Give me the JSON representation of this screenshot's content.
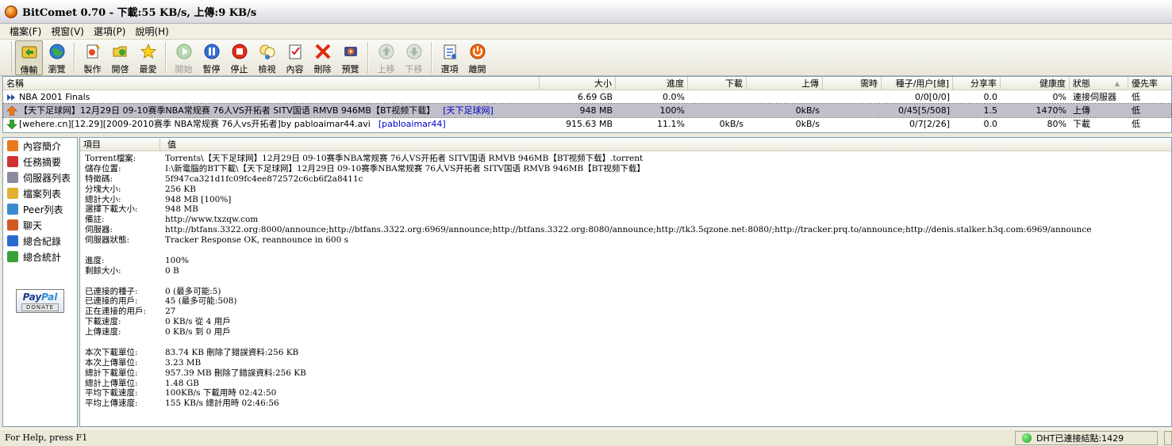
{
  "window": {
    "title": "BitComet 0.70 - 下載:55 KB/s, 上傳:9 KB/s"
  },
  "menu": [
    "檔案(F)",
    "視窗(V)",
    "選項(P)",
    "說明(H)"
  ],
  "toolbar": {
    "buttons": [
      {
        "label": "傳輸",
        "icon": "transfer-icon",
        "active": true,
        "disabled": false
      },
      {
        "label": "瀏覽",
        "icon": "globe-icon",
        "active": false,
        "disabled": false
      },
      {
        "label": "製作",
        "icon": "make-torrent-icon",
        "active": false,
        "disabled": false
      },
      {
        "label": "開啓",
        "icon": "open-folder-icon",
        "active": false,
        "disabled": false
      },
      {
        "label": "最愛",
        "icon": "star-icon",
        "active": false,
        "disabled": false
      },
      {
        "label": "開始",
        "icon": "play-icon",
        "active": false,
        "disabled": true
      },
      {
        "label": "暫停",
        "icon": "pause-icon",
        "active": false,
        "disabled": false
      },
      {
        "label": "停止",
        "icon": "stop-icon",
        "active": false,
        "disabled": false
      },
      {
        "label": "檢視",
        "icon": "view-icon",
        "active": false,
        "disabled": false
      },
      {
        "label": "內容",
        "icon": "properties-icon",
        "active": false,
        "disabled": false
      },
      {
        "label": "刪除",
        "icon": "delete-icon",
        "active": false,
        "disabled": false
      },
      {
        "label": "預覽",
        "icon": "preview-icon",
        "active": false,
        "disabled": false
      },
      {
        "label": "上移",
        "icon": "move-up-icon",
        "active": false,
        "disabled": true
      },
      {
        "label": "下移",
        "icon": "move-down-icon",
        "active": false,
        "disabled": true
      },
      {
        "label": "選項",
        "icon": "options-icon",
        "active": false,
        "disabled": false
      },
      {
        "label": "離開",
        "icon": "exit-icon",
        "active": false,
        "disabled": false
      }
    ]
  },
  "list": {
    "columns": [
      "名稱",
      "大小",
      "進度",
      "下載",
      "上傳",
      "需時",
      "種子/用户[總]",
      "分享率",
      "健康度",
      "狀態",
      "優先率"
    ],
    "rows": [
      {
        "icon": "double-arrow-icon",
        "name": "NBA 2001 Finals",
        "tag": "",
        "size": "6.69 GB",
        "progress": "0.0%",
        "down": "",
        "up": "",
        "eta": "",
        "peers": "0/0[0/0]",
        "ratio": "0.0",
        "health": "0%",
        "status": "連接伺服器",
        "priority": "低",
        "selected": false
      },
      {
        "icon": "upload-arrow-icon",
        "name": "【天下足球网】12月29日 09-10赛季NBA常规赛 76人VS开拓者 SITV国语 RMVB 946MB【BT视频下载】",
        "tag": "[天下足球网]",
        "size": "948 MB",
        "progress": "100%",
        "down": "",
        "up": "0kB/s",
        "eta": "",
        "peers": "0/45[5/508]",
        "ratio": "1.5",
        "health": "1470%",
        "status": "上傳",
        "priority": "低",
        "selected": true
      },
      {
        "icon": "download-arrow-icon",
        "name": "[wehere.cn][12.29][2009-2010赛季 NBA常规赛 76人vs开拓者]by pabloaimar44.avi",
        "tag": "[pabloaimar44]",
        "size": "915.63 MB",
        "progress": "11.1%",
        "down": "0kB/s",
        "up": "0kB/s",
        "eta": "",
        "peers": "0/7[2/26]",
        "ratio": "0.0",
        "health": "80%",
        "status": "下載",
        "priority": "低",
        "selected": false
      }
    ]
  },
  "nav": {
    "items": [
      {
        "label": "內容簡介",
        "icon": "info-icon"
      },
      {
        "label": "任務摘要",
        "icon": "task-summary-icon"
      },
      {
        "label": "伺服器列表",
        "icon": "server-list-icon"
      },
      {
        "label": "檔案列表",
        "icon": "file-list-icon"
      },
      {
        "label": "Peer列表",
        "icon": "peer-list-icon"
      },
      {
        "label": "聊天",
        "icon": "chat-icon"
      },
      {
        "label": "總合紀錄",
        "icon": "log-icon"
      },
      {
        "label": "總合統計",
        "icon": "statistics-icon"
      }
    ],
    "paypal": {
      "logo_a": "Pay",
      "logo_b": "Pal",
      "donate": "DONATE"
    }
  },
  "detail": {
    "columns": [
      "項目",
      "值"
    ],
    "groups": [
      [
        {
          "k": "Torrent檔案:",
          "v": "Torrents\\【天下足球网】12月29日 09-10赛季NBA常规赛 76人VS开拓者 SITV国语 RMVB 946MB【BT视频下载】.torrent"
        },
        {
          "k": "儲存位置:",
          "v": "I:\\新電腦的BT下載\\【天下足球网】12月29日 09-10赛季NBA常规赛 76人VS开拓者 SITV国语 RMVB 946MB【BT视频下载】"
        },
        {
          "k": "特徵碼:",
          "v": "5f947ca321d1fc09fc4ee872572c6cb6f2a8411c"
        },
        {
          "k": "分塊大小:",
          "v": "256 KB"
        },
        {
          "k": "總計大小:",
          "v": "948 MB [100%]"
        },
        {
          "k": "選擇下載大小:",
          "v": "948 MB"
        },
        {
          "k": "備註:",
          "v": "http://www.txzqw.com"
        },
        {
          "k": "伺服器:",
          "v": "http://btfans.3322.org:8000/announce;http://btfans.3322.org:6969/announce;http://btfans.3322.org:8080/announce;http://tk3.5qzone.net:8080/;http://tracker.prq.to/announce;http://denis.stalker.h3q.com:6969/announce"
        },
        {
          "k": "伺服器狀態:",
          "v": "Tracker Response OK, reannounce in 600 s"
        }
      ],
      [
        {
          "k": "進度:",
          "v": "100%"
        },
        {
          "k": "剩餘大小:",
          "v": "0 B"
        }
      ],
      [
        {
          "k": "已連接的種子:",
          "v": "0 (最多可能:5)"
        },
        {
          "k": "已連接的用戶:",
          "v": "45 (最多可能:508)"
        },
        {
          "k": "正在連接的用戶:",
          "v": "27"
        },
        {
          "k": "下載速度:",
          "v": "0 KB/s 從 4 用戶"
        },
        {
          "k": "上傳速度:",
          "v": "0 KB/s 到 0 用戶"
        }
      ],
      [
        {
          "k": "本次下載單位:",
          "v": "83.74 KB 刪除了錯誤資料:256 KB"
        },
        {
          "k": "本次上傳單位:",
          "v": "3.23 MB"
        },
        {
          "k": "總計下載單位:",
          "v": "957.39 MB 刪除了錯誤資料:256 KB"
        },
        {
          "k": "總計上傳單位:",
          "v": "1.48 GB"
        },
        {
          "k": "平均下載速度:",
          "v": "100KB/s 下載用時 02:42:50"
        },
        {
          "k": "平均上傳速度:",
          "v": "155 KB/s 總計用時 02:46:56"
        }
      ]
    ]
  },
  "status": {
    "help": "For Help, press F1",
    "dht": "DHT已連接結點:1429"
  },
  "colors": {
    "selected_row": "#c1bfc9",
    "link": "#0000c8",
    "window_bg": "#ece9d8"
  }
}
